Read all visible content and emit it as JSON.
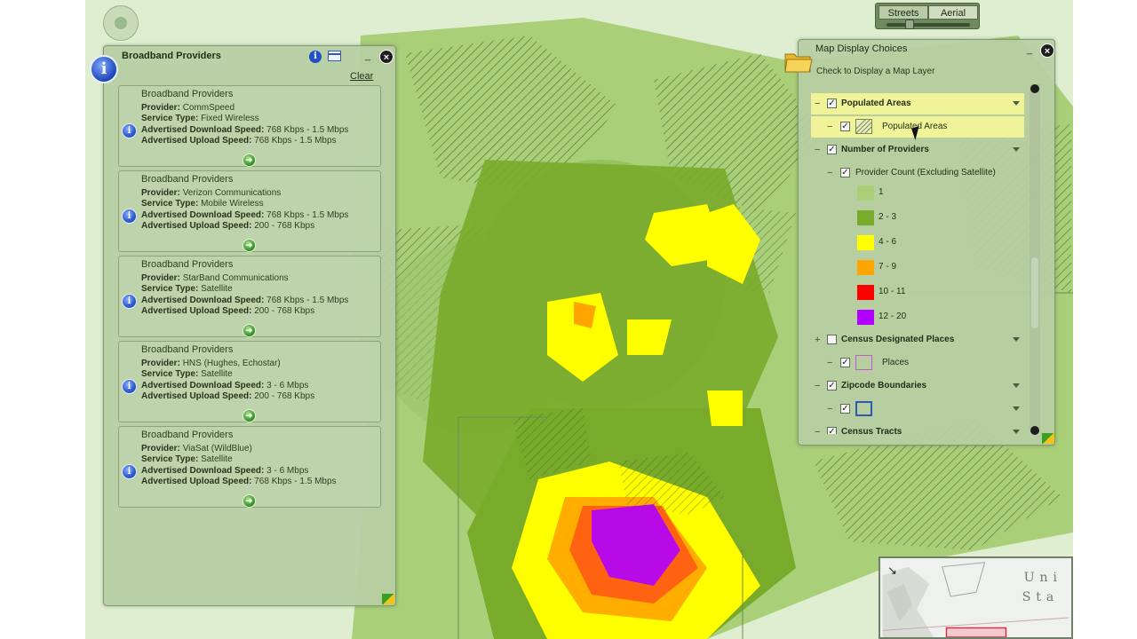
{
  "map_type": {
    "streets_label": "Streets",
    "aerial_label": "Aerial"
  },
  "colors": {
    "providers_1": "#a9cf79",
    "providers_2_3": "#79ab2b",
    "providers_4_6": "#ffff00",
    "providers_7_9": "#ffa500",
    "providers_10_11": "#ff0000",
    "providers_12_20": "#b000ff"
  },
  "broadband_panel": {
    "title": "Broadband Providers",
    "clear_label": "Clear",
    "field_labels": {
      "provider": "Provider:",
      "service_type": "Service Type:",
      "download": "Advertised Download Speed:",
      "upload": "Advertised Upload Speed:"
    },
    "cards": [
      {
        "title": "Broadband Providers",
        "provider": "CommSpeed",
        "service_type": "Fixed Wireless",
        "download": "768 Kbps - 1.5 Mbps",
        "upload": "768 Kbps - 1.5 Mbps"
      },
      {
        "title": "Broadband Providers",
        "provider": "Verizon Communications",
        "service_type": "Mobile Wireless",
        "download": "768 Kbps - 1.5 Mbps",
        "upload": "200 - 768 Kbps"
      },
      {
        "title": "Broadband Providers",
        "provider": "StarBand Communications",
        "service_type": "Satellite",
        "download": "768 Kbps - 1.5 Mbps",
        "upload": "200 - 768 Kbps"
      },
      {
        "title": "Broadband Providers",
        "provider": "HNS (Hughes, Echostar)",
        "service_type": "Satellite",
        "download": "3 - 6 Mbps",
        "upload": "200 - 768 Kbps"
      },
      {
        "title": "Broadband Providers",
        "provider": "ViaSat (WildBlue)",
        "service_type": "Satellite",
        "download": "3 - 6 Mbps",
        "upload": "768 Kbps - 1.5 Mbps"
      }
    ]
  },
  "map_display_panel": {
    "title": "Map Display Choices",
    "subtitle": "Check to Display a Map Layer",
    "layers": {
      "populated_areas": "Populated Areas",
      "populated_areas_item": "Populated Areas",
      "number_of_providers": "Number of Providers",
      "provider_count": "Provider Count (Excluding Satellite)",
      "legend": [
        {
          "label": "1",
          "color": "#a9cf79"
        },
        {
          "label": "2 - 3",
          "color": "#79ab2b"
        },
        {
          "label": "4 - 6",
          "color": "#ffff00"
        },
        {
          "label": "7 - 9",
          "color": "#ffa500"
        },
        {
          "label": "10 - 11",
          "color": "#ff0000"
        },
        {
          "label": "12 - 20",
          "color": "#b000ff"
        }
      ],
      "census_places": "Census Designated Places",
      "places": "Places",
      "zipcode": "Zipcode Boundaries",
      "census_tracts": "Census Tracts"
    }
  },
  "overview_map": {
    "label_1": "Uni",
    "label_2": "Sta"
  }
}
